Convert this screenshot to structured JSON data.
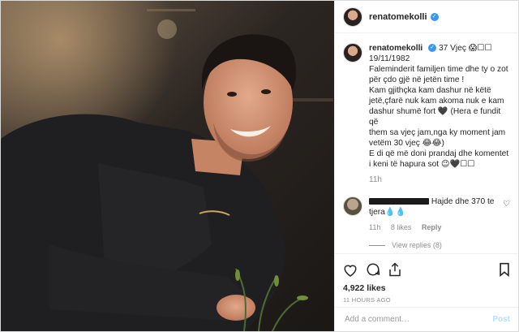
{
  "header": {
    "username": "renatomekolli",
    "verified_icon": "verified-badge-icon"
  },
  "caption": {
    "username": "renatomekolli",
    "line1": "37 Vjeç 😱☐☐",
    "line2": "19/11/1982",
    "line3": "Faleminderit familjen time dhe ty o zot",
    "line4": "për çdo gjë në jetën time !",
    "line5": "Kam gjithçka kam dashur në këtë",
    "line6": "jetë,çfarë nuk kam akoma nuk e kam",
    "line7": "dashur shumë fort 🖤 (Hera e fundit që",
    "line8": "them sa vjeç jam,nga ky moment jam",
    "line9": "vetëm 30 vjeç 😂😂)",
    "line10": "E di që më doni prandaj dhe komentet",
    "line11": "i keni të hapura sot 😉🖤☐☐",
    "time": "11h"
  },
  "comment": {
    "text": "Hajde dhe 370 te",
    "text2": "tjera💧💧",
    "time": "11h",
    "likes": "8 likes",
    "reply": "Reply",
    "view_replies": "View replies (8)"
  },
  "actions": {
    "likes": "4,922 likes",
    "time_ago": "11 HOURS AGO"
  },
  "add_comment": {
    "placeholder": "Add a comment…",
    "post_label": "Post"
  },
  "colors": {
    "link": "#3897f0",
    "muted": "#8e8e8e",
    "post_disabled": "#b2dffc"
  }
}
